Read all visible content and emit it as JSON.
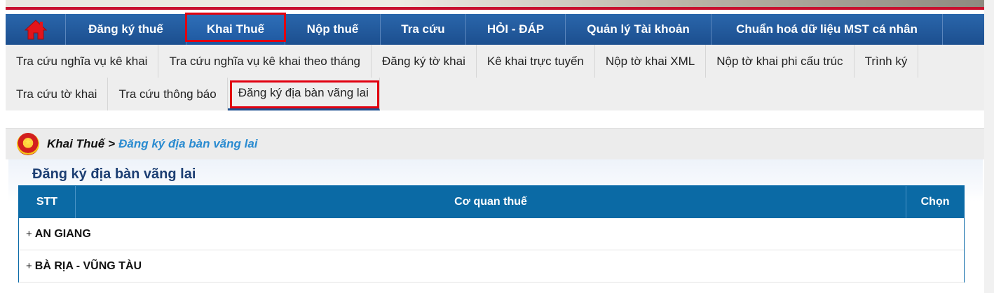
{
  "main_nav": {
    "items": [
      {
        "label": "Đăng ký thuế"
      },
      {
        "label": "Khai Thuế"
      },
      {
        "label": "Nộp thuế"
      },
      {
        "label": "Tra cứu"
      },
      {
        "label": "HỎI - ĐÁP"
      },
      {
        "label": "Quản lý Tài khoản"
      },
      {
        "label": "Chuẩn hoá dữ liệu MST cá nhân"
      }
    ],
    "active": "Khai Thuế"
  },
  "sub_nav": {
    "row1": [
      "Tra cứu nghĩa vụ kê khai",
      "Tra cứu nghĩa vụ kê khai theo tháng",
      "Đăng ký tờ khai",
      "Kê khai trực tuyến",
      "Nộp tờ khai XML",
      "Nộp tờ khai phi cấu trúc",
      "Trình ký"
    ],
    "row2": [
      "Tra cứu tờ khai",
      "Tra cứu thông báo",
      "Đăng ký địa bàn vãng lai"
    ],
    "active": "Đăng ký địa bàn vãng lai"
  },
  "breadcrumb": {
    "root": "Khai Thuế",
    "separator": ">",
    "current": "Đăng ký địa bàn vãng lai"
  },
  "page_title": "Đăng ký địa bàn vãng lai",
  "table": {
    "headers": [
      "STT",
      "Cơ quan thuế",
      "Chọn"
    ],
    "rows": [
      {
        "toggle": "+",
        "name": "AN GIANG"
      },
      {
        "toggle": "+",
        "name": "BÀ RỊA - VŨNG TÀU"
      }
    ]
  },
  "colors": {
    "nav_blue": "#1c4f8f",
    "highlight_red": "#e10010",
    "table_header": "#0b6aa5",
    "breadcrumb_link": "#2a8bd0"
  }
}
